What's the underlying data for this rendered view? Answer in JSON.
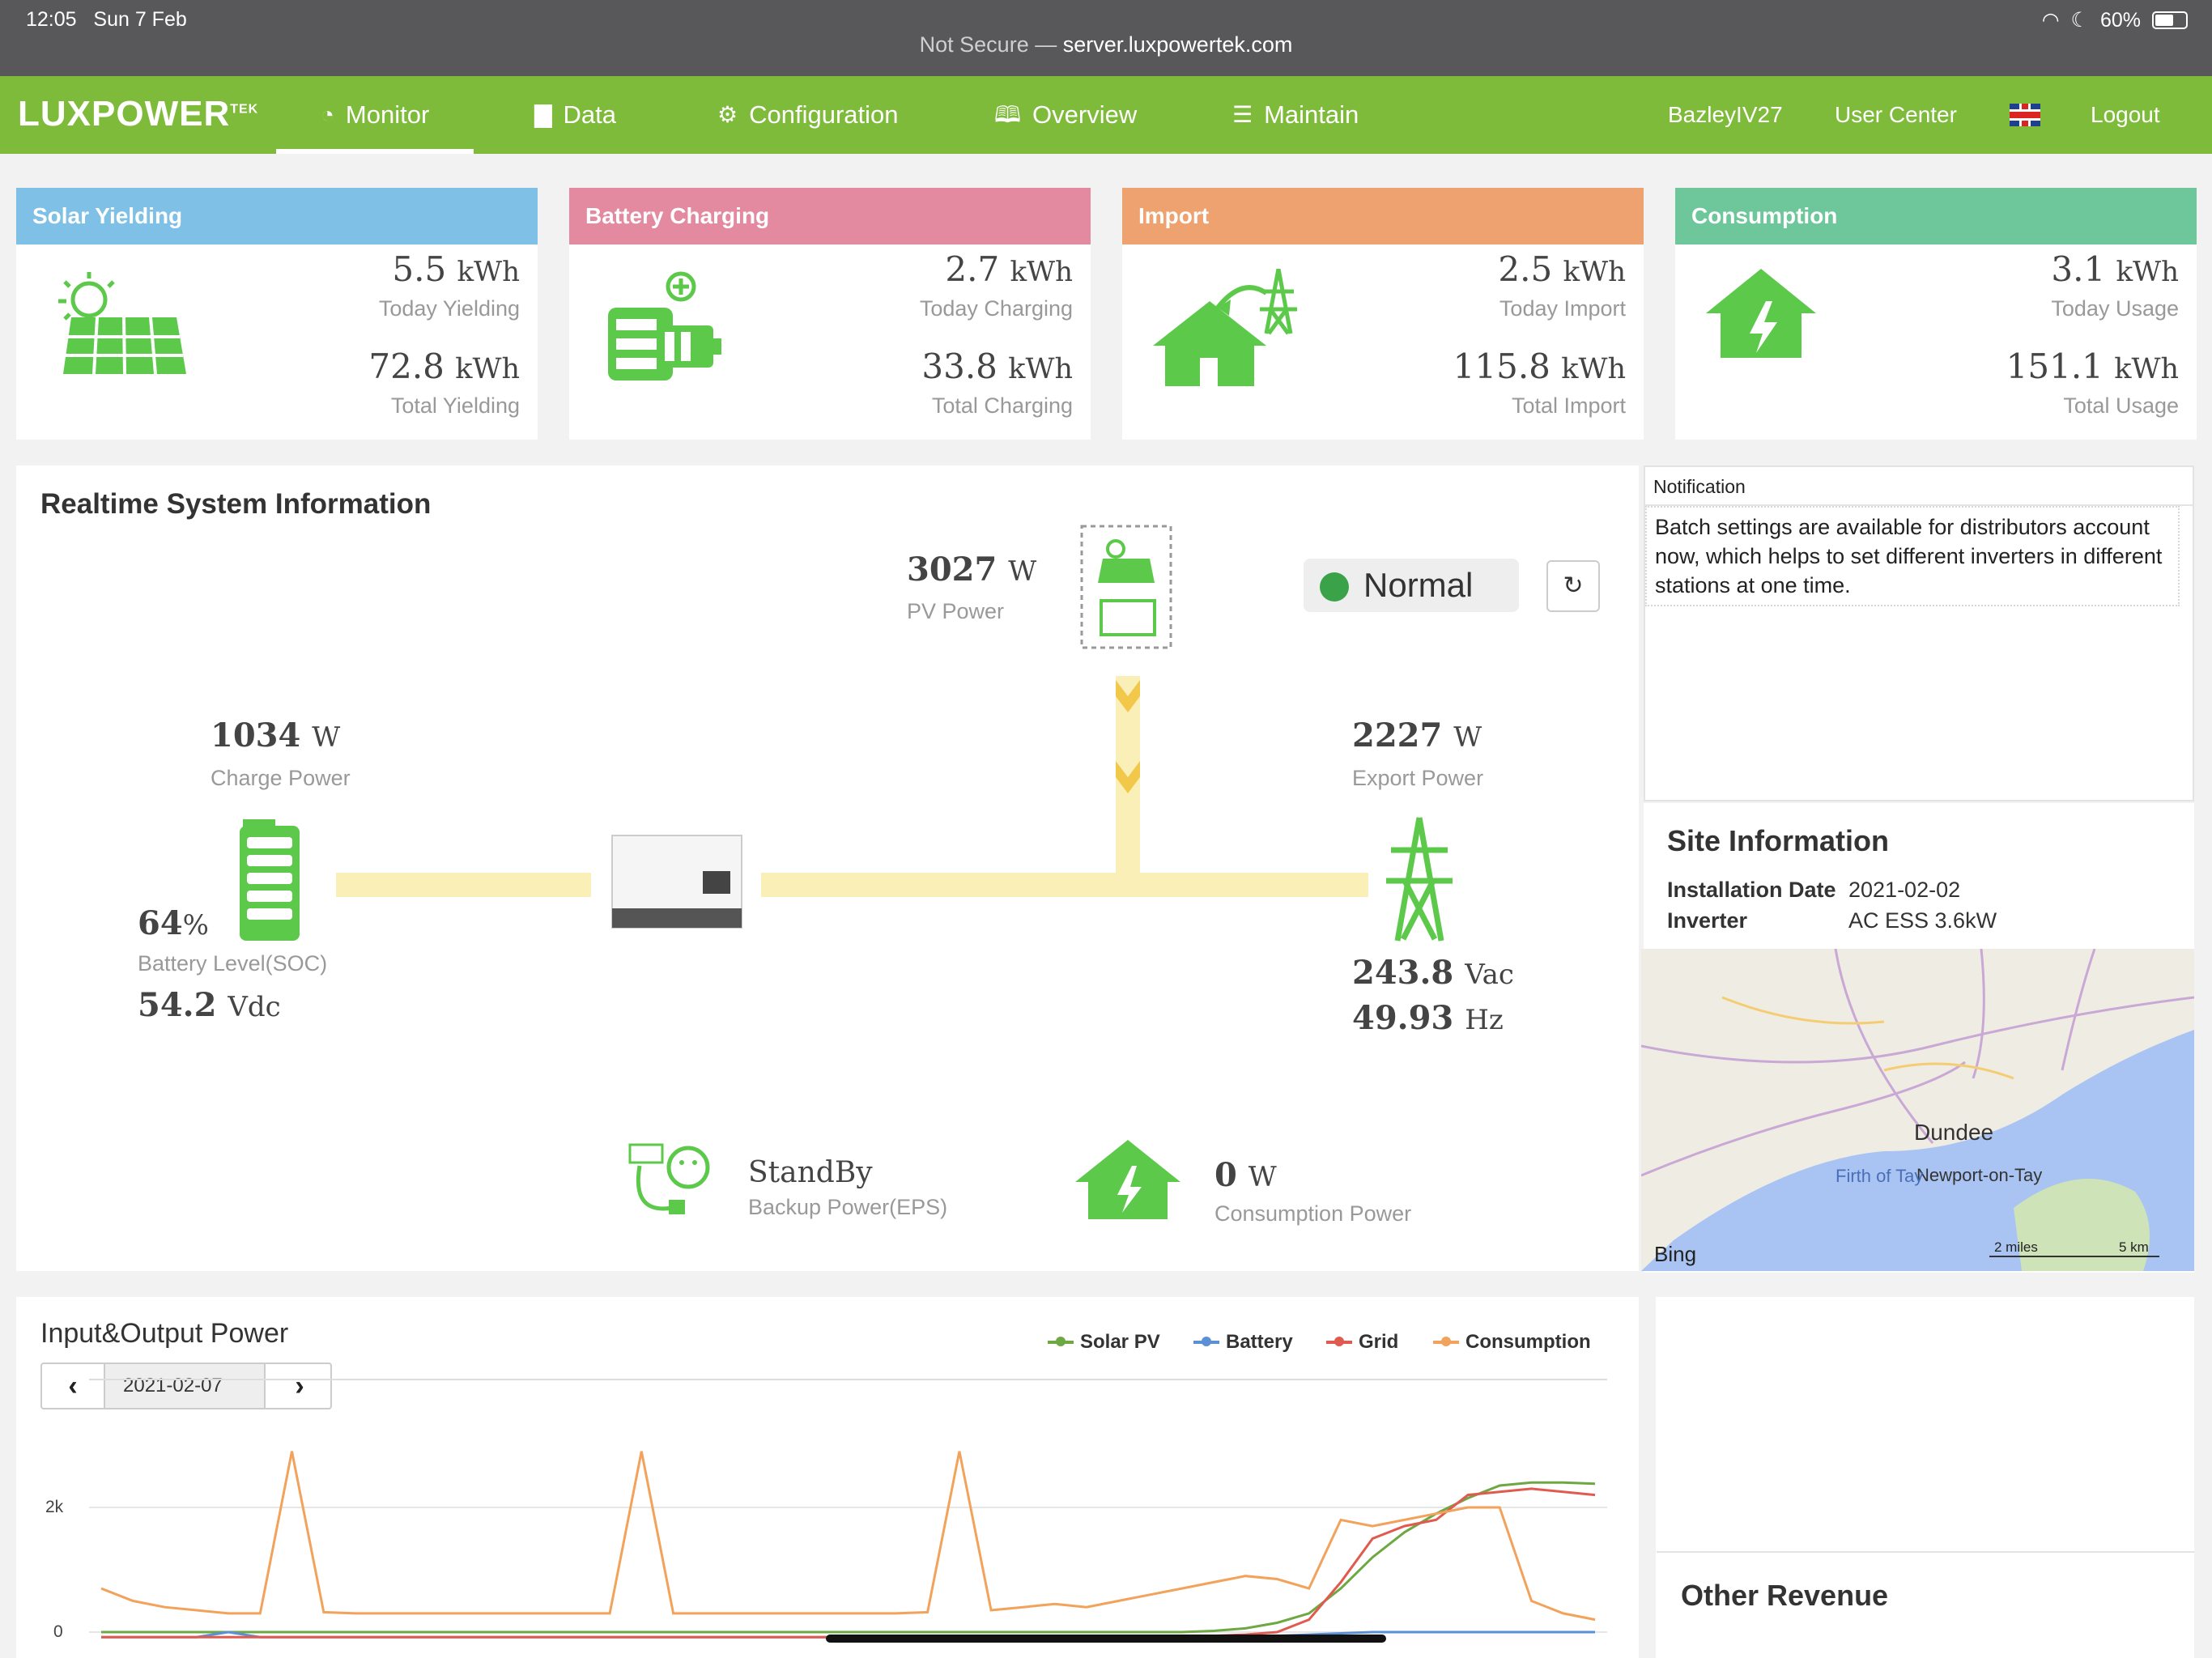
{
  "status_bar": {
    "time": "12:05",
    "date": "Sun 7 Feb",
    "not_secure": "Not Secure —",
    "domain": "server.luxpowertek.com",
    "battery": "60%"
  },
  "nav": {
    "logo": "LUXPOWER",
    "logo_sup": "TEK",
    "items": [
      {
        "label": "Monitor",
        "icon": "dashboard-icon"
      },
      {
        "label": "Data",
        "icon": "bar-chart-icon"
      },
      {
        "label": "Configuration",
        "icon": "gears-icon"
      },
      {
        "label": "Overview",
        "icon": "book-icon"
      },
      {
        "label": "Maintain",
        "icon": "file-icon"
      }
    ],
    "user": "BazleyIV27",
    "user_center": "User Center",
    "logout": "Logout"
  },
  "cards": [
    {
      "title": "Solar Yielding",
      "color": "#7ec0e6",
      "today": "5.5",
      "today_label": "Today Yielding",
      "total": "72.8",
      "total_label": "Total Yielding",
      "unit": "kWh"
    },
    {
      "title": "Battery Charging",
      "color": "#e48aa0",
      "today": "2.7",
      "today_label": "Today Charging",
      "total": "33.8",
      "total_label": "Total Charging",
      "unit": "kWh"
    },
    {
      "title": "Import",
      "color": "#eda270",
      "today": "2.5",
      "today_label": "Today Import",
      "total": "115.8",
      "total_label": "Total Import",
      "unit": "kWh"
    },
    {
      "title": "Consumption",
      "color": "#6dc79a",
      "today": "3.1",
      "today_label": "Today Usage",
      "total": "151.1",
      "total_label": "Total Usage",
      "unit": "kWh"
    }
  ],
  "realtime": {
    "title": "Realtime System Information",
    "pv_power": "3027",
    "pv_power_label": "PV Power",
    "status": "Normal",
    "charge_power": "1034",
    "charge_power_label": "Charge Power",
    "export_power": "2227",
    "export_power_label": "Export Power",
    "soc": "64",
    "soc_label": "Battery Level(SOC)",
    "battery_voltage": "54.2",
    "battery_voltage_unit": "Vdc",
    "grid_voltage": "243.8",
    "grid_voltage_unit": "Vac",
    "grid_freq": "49.93",
    "grid_freq_unit": "Hz",
    "eps_status": "StandBy",
    "eps_label": "Backup Power(EPS)",
    "consumption_power": "0",
    "consumption_power_label": "Consumption Power",
    "watt_unit": "W",
    "percent_unit": "%"
  },
  "notification": {
    "title": "Notification",
    "text": "Batch settings are available for distributors account now, which helps to set different inverters in different stations at one time."
  },
  "site": {
    "title": "Site Information",
    "install_label": "Installation Date",
    "install_date": "2021-02-02",
    "inverter_label": "Inverter",
    "inverter": "AC ESS 3.6kW",
    "map_labels": {
      "city": "Dundee",
      "town": "Newport-on-Tay",
      "water": "Firth of Tay",
      "brand": "Bing",
      "scale_mi": "2 miles",
      "scale_km": "5 km"
    }
  },
  "chart": {
    "title": "Input&Output Power",
    "date": "2021-02-07",
    "legend": [
      {
        "name": "Solar PV",
        "color": "#6ea843"
      },
      {
        "name": "Battery",
        "color": "#5b8fd6"
      },
      {
        "name": "Grid",
        "color": "#e05a4f"
      },
      {
        "name": "Consumption",
        "color": "#f2a25a"
      }
    ]
  },
  "chart_data": {
    "type": "line",
    "title": "Input&Output Power",
    "y_ticks": [
      "2k",
      "0"
    ],
    "ylim": [
      0,
      2000
    ],
    "series": [
      {
        "name": "Solar PV",
        "values": [
          0,
          0,
          0,
          0,
          0,
          0,
          0,
          0,
          0,
          0,
          0,
          0,
          0,
          0,
          0,
          0,
          0,
          0,
          0,
          0,
          0,
          0,
          0,
          0,
          0,
          0,
          0,
          0,
          0,
          0,
          0,
          0,
          0,
          0,
          0,
          20,
          60,
          150,
          300,
          700,
          1200,
          1600,
          1900,
          2150,
          2350,
          2400,
          2400,
          2380
        ]
      },
      {
        "name": "Battery",
        "values": [
          -80,
          -80,
          -80,
          -80,
          0,
          -80,
          -80,
          -80,
          -80,
          -80,
          -80,
          -80,
          -80,
          -80,
          -80,
          -80,
          -80,
          -80,
          -80,
          -80,
          -80,
          -80,
          -80,
          -80,
          -80,
          -80,
          -80,
          -80,
          -80,
          -80,
          -80,
          -80,
          -80,
          -80,
          -80,
          -80,
          -80,
          -60,
          -40,
          -20,
          0,
          0,
          0,
          0,
          0,
          0,
          0,
          0
        ]
      },
      {
        "name": "Grid",
        "values": [
          -80,
          -80,
          -80,
          -80,
          -80,
          -80,
          -80,
          -80,
          -80,
          -80,
          -80,
          -80,
          -80,
          -80,
          -80,
          -80,
          -80,
          -80,
          -80,
          -80,
          -80,
          -80,
          -80,
          -80,
          -80,
          -80,
          -80,
          -80,
          -80,
          -80,
          -80,
          -80,
          -80,
          -80,
          -80,
          -60,
          -40,
          0,
          200,
          800,
          1500,
          1700,
          1800,
          2200,
          2250,
          2300,
          2250,
          2200
        ]
      },
      {
        "name": "Consumption",
        "values": [
          700,
          500,
          400,
          350,
          300,
          300,
          2900,
          320,
          300,
          300,
          300,
          300,
          300,
          300,
          300,
          300,
          300,
          2900,
          300,
          300,
          300,
          300,
          300,
          300,
          300,
          300,
          320,
          2900,
          350,
          400,
          450,
          400,
          500,
          600,
          700,
          800,
          900,
          850,
          700,
          1800,
          1700,
          1800,
          1900,
          2000,
          2000,
          500,
          300,
          200
        ]
      }
    ]
  },
  "other_revenue": "Other Revenue"
}
